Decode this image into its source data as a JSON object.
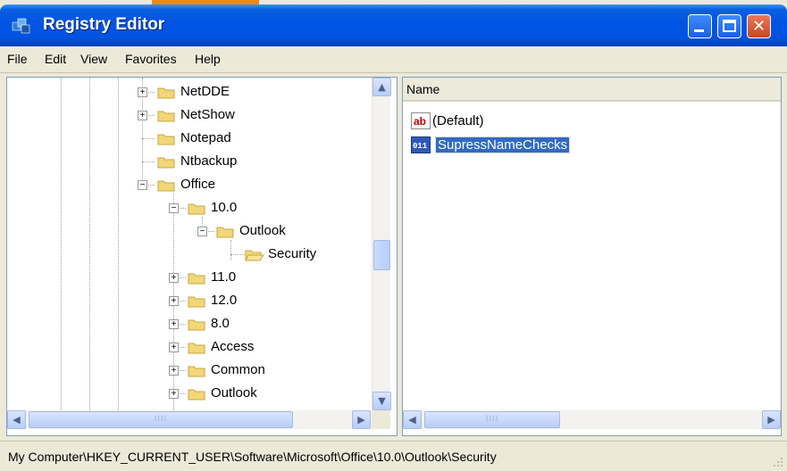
{
  "window": {
    "title": "Registry Editor",
    "controls": {
      "minimize": "minimize",
      "maximize": "maximize",
      "close": "close"
    }
  },
  "menu": [
    "File",
    "Edit",
    "View",
    "Favorites",
    "Help"
  ],
  "tree": {
    "nodes": [
      {
        "label": "NetDDE",
        "expander": "+",
        "level": 0
      },
      {
        "label": "NetShow",
        "expander": "+",
        "level": 0
      },
      {
        "label": "Notepad",
        "expander": "",
        "level": 0
      },
      {
        "label": "Ntbackup",
        "expander": "",
        "level": 0
      },
      {
        "label": "Office",
        "expander": "−",
        "level": 0
      },
      {
        "label": "10.0",
        "expander": "−",
        "level": 1
      },
      {
        "label": "Outlook",
        "expander": "−",
        "level": 2
      },
      {
        "label": "Security",
        "expander": "",
        "level": 3,
        "open": true
      },
      {
        "label": "11.0",
        "expander": "+",
        "level": 1
      },
      {
        "label": "12.0",
        "expander": "+",
        "level": 1
      },
      {
        "label": "8.0",
        "expander": "+",
        "level": 1
      },
      {
        "label": "Access",
        "expander": "+",
        "level": 1
      },
      {
        "label": "Common",
        "expander": "+",
        "level": 1
      },
      {
        "label": "Outlook",
        "expander": "+",
        "level": 1
      }
    ],
    "scroll_up_glyph": "▲",
    "scroll_down_glyph": "▼",
    "scroll_left_glyph": "◀",
    "scroll_right_glyph": "▶",
    "thumb_grip": "IIII"
  },
  "list": {
    "header_name": "Name",
    "rows": [
      {
        "name": "(Default)",
        "icon": "string-value-icon",
        "icon_text": "ab"
      },
      {
        "name": "SupressNameChecks",
        "icon": "binary-value-icon",
        "icon_text": "011",
        "selected": true
      }
    ]
  },
  "status": {
    "path": "My Computer\\HKEY_CURRENT_USER\\Software\\Microsoft\\Office\\10.0\\Outlook\\Security"
  },
  "colors": {
    "titlebar": "#0054e3",
    "selection": "#316ac5",
    "folder": "#f2d77a"
  }
}
